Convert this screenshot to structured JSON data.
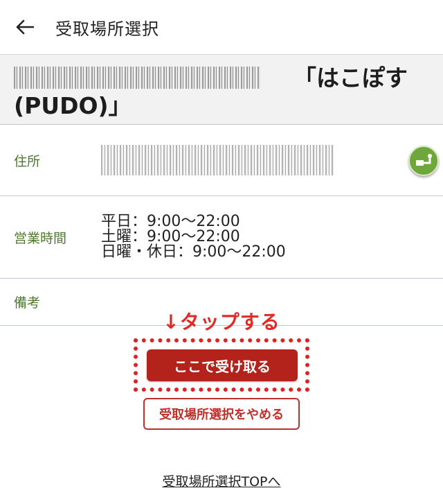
{
  "header": {
    "title": "受取場所選択",
    "back_icon": "arrow-left-icon"
  },
  "store": {
    "name_suffix": "「はこぽす",
    "name_line2": "(PUDO)」"
  },
  "info": {
    "address_label": "住所",
    "hours_label": "営業時間",
    "hours": [
      "平日：9:00～22:00",
      "土曜：9:00～22:00",
      "日曜・休日：9:00～22:00"
    ],
    "notes_label": "備考",
    "map_icon": "map-route-icon"
  },
  "actions": {
    "tap_hint": "↓タップする",
    "receive_here": "ここで受け取る",
    "cancel": "受取場所選択をやめる"
  },
  "footer": {
    "top_link": "受取場所選択TOPへ"
  },
  "colors": {
    "accent_red": "#b3231c",
    "label_green": "#4d7a2e",
    "hint_red": "#e02a23"
  }
}
